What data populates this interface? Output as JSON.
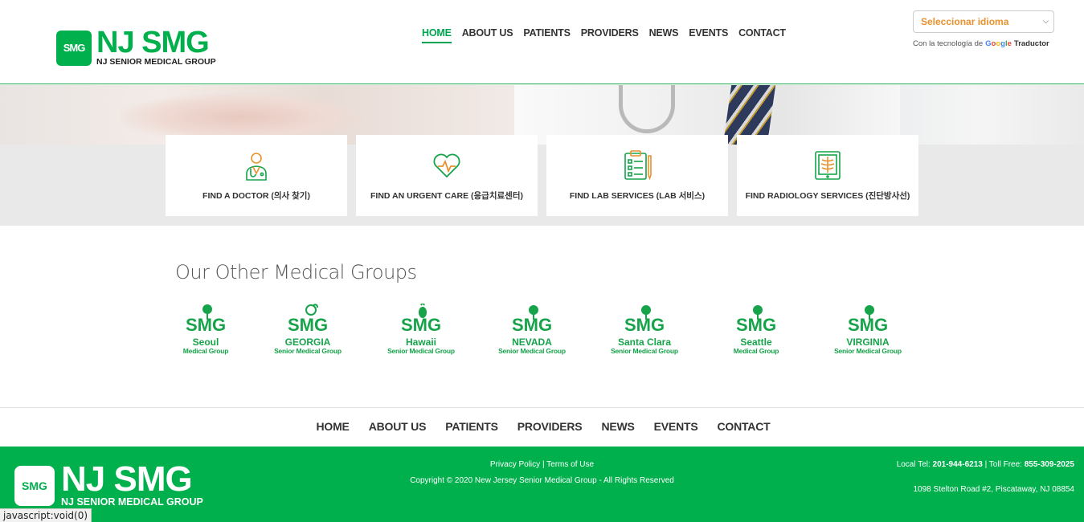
{
  "header": {
    "logo_main": "NJ SMG",
    "logo_sub": "NJ SENIOR MEDICAL GROUP",
    "logo_badge": "SMG",
    "nav": [
      "HOME",
      "ABOUT US",
      "PATIENTS",
      "PROVIDERS",
      "NEWS",
      "EVENTS",
      "CONTACT"
    ],
    "active_nav": "HOME",
    "language_select": "Seleccionar idioma",
    "powered_by": "Con la tecnología de",
    "google": "Google",
    "translator": "Traductor"
  },
  "services": [
    {
      "label": "FIND A DOCTOR (의사 찾기)",
      "icon": "doctor-icon"
    },
    {
      "label": "FIND AN URGENT CARE (응급치료센터)",
      "icon": "heartbeat-icon"
    },
    {
      "label": "FIND LAB SERVICES (LAB 서비스)",
      "icon": "clipboard-icon"
    },
    {
      "label": "FIND RADIOLOGY SERVICES (진단방사선)",
      "icon": "xray-icon"
    }
  ],
  "groups": {
    "title": "Our Other Medical Groups",
    "items": [
      {
        "name": "Seoul",
        "sub": "Medical Group"
      },
      {
        "name": "GEORGIA",
        "sub": "Senior Medical Group"
      },
      {
        "name": "Hawaii",
        "sub": "Senior Medical Group"
      },
      {
        "name": "NEVADA",
        "sub": "Senior Medical Group"
      },
      {
        "name": "Santa Clara",
        "sub": "Senior Medical Group"
      },
      {
        "name": "Seattle",
        "sub": "Medical Group"
      },
      {
        "name": "VIRGINIA",
        "sub": "Senior Medical Group"
      }
    ],
    "mark_text": "SMG"
  },
  "footer_nav": [
    "HOME",
    "ABOUT US",
    "PATIENTS",
    "PROVIDERS",
    "NEWS",
    "EVENTS",
    "CONTACT"
  ],
  "footer": {
    "privacy": "Privacy Policy",
    "separator": " | ",
    "terms": "Terms of Use",
    "copyright": "Copyright © 2020 New Jersey Senior Medical Group - All Rights Reserved",
    "local_tel_label": "Local Tel:",
    "local_tel": "201-944-6213",
    "toll_free_label": "| Toll Free:",
    "toll_free": "855-309-2025",
    "address": "1098 Stelton Road #2, Piscataway, NJ 08854",
    "logo_main": "NJ SMG",
    "logo_sub": "NJ SENIOR MEDICAL GROUP",
    "logo_badge": "SMG"
  },
  "status_bar": "javascript:void(0)",
  "colors": {
    "brand": "#00b04d",
    "accent_orange": "#e8912d"
  }
}
